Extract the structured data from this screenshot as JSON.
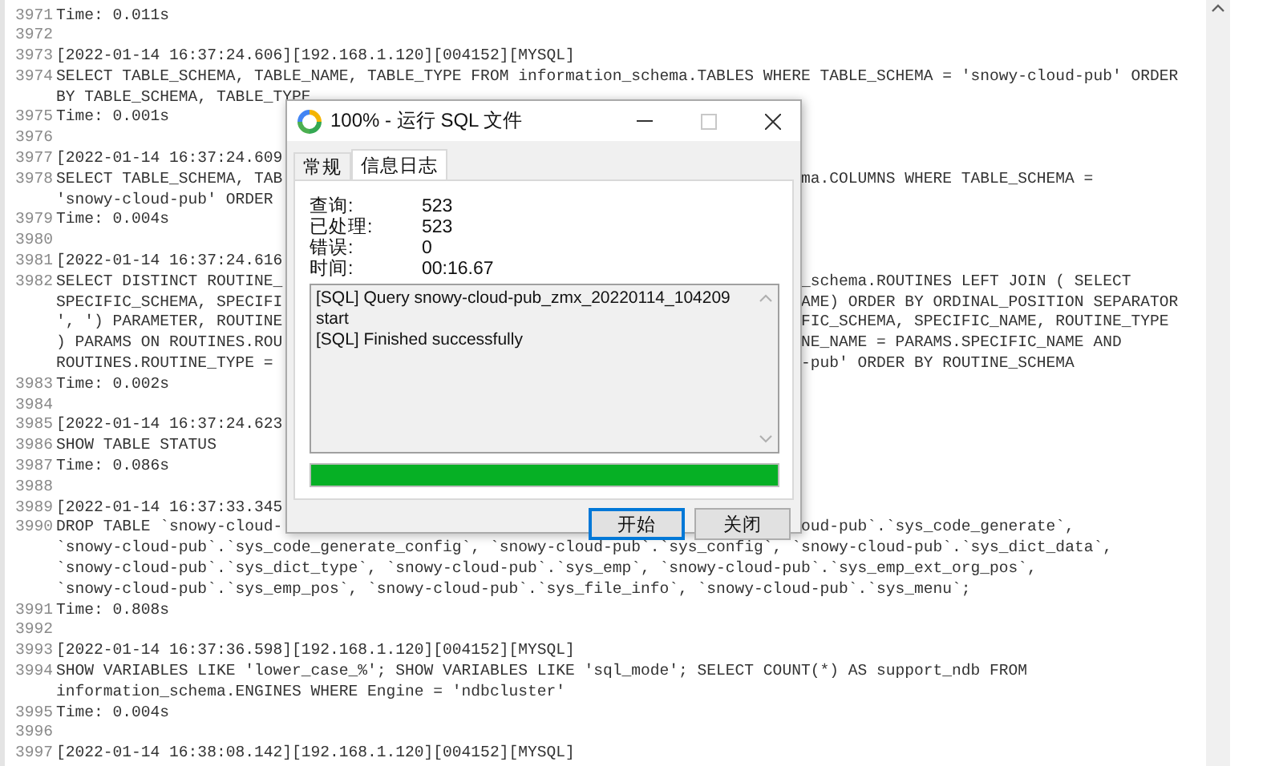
{
  "editor": {
    "lines": [
      {
        "number": "3971",
        "rows": [
          {
            "text": "Time: 0.011s"
          }
        ]
      },
      {
        "number": "3972"
      },
      {
        "number": "3973",
        "rows": [
          {
            "text": "[2022-01-14 16:37:24.606][192.168.1.120][004152][MYSQL]"
          }
        ]
      },
      {
        "number": "3974",
        "rows": [
          {
            "text": "SELECT TABLE_SCHEMA, TABLE_NAME, TABLE_TYPE FROM information_schema.TABLES WHERE TABLE_SCHEMA = 'snowy-cloud-pub' ORDER"
          },
          {
            "text": "BY TABLE_SCHEMA, TABLE_TYPE"
          }
        ]
      },
      {
        "number": "3975",
        "rows": [
          {
            "text": "Time: 0.001s"
          }
        ]
      },
      {
        "number": "3976"
      },
      {
        "number": "3977",
        "rows": [
          {
            "text": "[2022-01-14 16:37:24.609"
          }
        ]
      },
      {
        "number": "3978",
        "rows": [
          {
            "text": "SELECT TABLE_SCHEMA, TAB",
            "text_right": "ma.COLUMNS WHERE TABLE_SCHEMA ="
          },
          {
            "text": "'snowy-cloud-pub' ORDER"
          }
        ]
      },
      {
        "number": "3979",
        "rows": [
          {
            "text": "Time: 0.004s"
          }
        ]
      },
      {
        "number": "3980"
      },
      {
        "number": "3981",
        "rows": [
          {
            "text": "[2022-01-14 16:37:24.616"
          }
        ]
      },
      {
        "number": "3982",
        "rows": [
          {
            "text": "SELECT DISTINCT ROUTINE_",
            "text_right": "_schema.ROUTINES LEFT JOIN ( SELECT"
          },
          {
            "text": "SPECIFIC_SCHEMA, SPECIFI",
            "text_right": "AME) ORDER BY ORDINAL_POSITION SEPARATOR"
          },
          {
            "text": "', ') PARAMETER, ROUTINE",
            "text_right": "FIC_SCHEMA, SPECIFIC_NAME, ROUTINE_TYPE"
          },
          {
            "text": ") PARAMS ON ROUTINES.ROU",
            "text_right": "NE_NAME = PARAMS.SPECIFIC_NAME AND"
          },
          {
            "text": "ROUTINES.ROUTINE_TYPE =",
            "text_right": "-pub' ORDER BY ROUTINE_SCHEMA"
          }
        ]
      },
      {
        "number": "3983",
        "rows": [
          {
            "text": "Time: 0.002s"
          }
        ]
      },
      {
        "number": "3984"
      },
      {
        "number": "3985",
        "rows": [
          {
            "text": "[2022-01-14 16:37:24.623"
          }
        ]
      },
      {
        "number": "3986",
        "rows": [
          {
            "text": "SHOW TABLE STATUS"
          }
        ]
      },
      {
        "number": "3987",
        "rows": [
          {
            "text": "Time: 0.086s"
          }
        ]
      },
      {
        "number": "3988"
      },
      {
        "number": "3989",
        "rows": [
          {
            "text": "[2022-01-14 16:37:33.345"
          }
        ]
      },
      {
        "number": "3990",
        "rows": [
          {
            "text": "DROP TABLE `snowy-cloud-",
            "text_right": "oud-pub`.`sys_code_generate`,"
          },
          {
            "text": "`snowy-cloud-pub`.`sys_code_generate_config`, `snowy-cloud-pub`.`sys_config`, `snowy-cloud-pub`.`sys_dict_data`,"
          },
          {
            "text": "`snowy-cloud-pub`.`sys_dict_type`, `snowy-cloud-pub`.`sys_emp`, `snowy-cloud-pub`.`sys_emp_ext_org_pos`,"
          },
          {
            "text": "`snowy-cloud-pub`.`sys_emp_pos`, `snowy-cloud-pub`.`sys_file_info`, `snowy-cloud-pub`.`sys_menu`;"
          }
        ]
      },
      {
        "number": "3991",
        "rows": [
          {
            "text": "Time: 0.808s"
          }
        ]
      },
      {
        "number": "3992"
      },
      {
        "number": "3993",
        "rows": [
          {
            "text": "[2022-01-14 16:37:36.598][192.168.1.120][004152][MYSQL]"
          }
        ]
      },
      {
        "number": "3994",
        "rows": [
          {
            "text": "SHOW VARIABLES LIKE 'lower_case_%'; SHOW VARIABLES LIKE 'sql_mode'; SELECT COUNT(*) AS support_ndb FROM"
          },
          {
            "text": "information_schema.ENGINES WHERE Engine = 'ndbcluster'"
          }
        ]
      },
      {
        "number": "3995",
        "rows": [
          {
            "text": "Time: 0.004s"
          }
        ]
      },
      {
        "number": "3996"
      },
      {
        "number": "3997",
        "rows": [
          {
            "text": "[2022-01-14 16:38:08.142][192.168.1.120][004152][MYSQL]"
          }
        ]
      }
    ]
  },
  "dialog": {
    "title": "100% - 运行 SQL 文件",
    "tabs": [
      {
        "label": "常规",
        "selected": false
      },
      {
        "label": "信息日志",
        "selected": true
      }
    ],
    "stats": [
      {
        "label": "查询:",
        "value": "523"
      },
      {
        "label": "已处理:",
        "value": "523"
      },
      {
        "label": "错误:",
        "value": "0"
      },
      {
        "label": "时间:",
        "value": "00:16.67"
      }
    ],
    "log": [
      "[SQL] Query snowy-cloud-pub_zmx_20220114_104209 start",
      "[SQL] Finished successfully"
    ],
    "progress": {
      "level": 1
    },
    "buttons": [
      {
        "label": "开始",
        "default": true
      },
      {
        "label": "关闭",
        "default": false
      }
    ]
  }
}
